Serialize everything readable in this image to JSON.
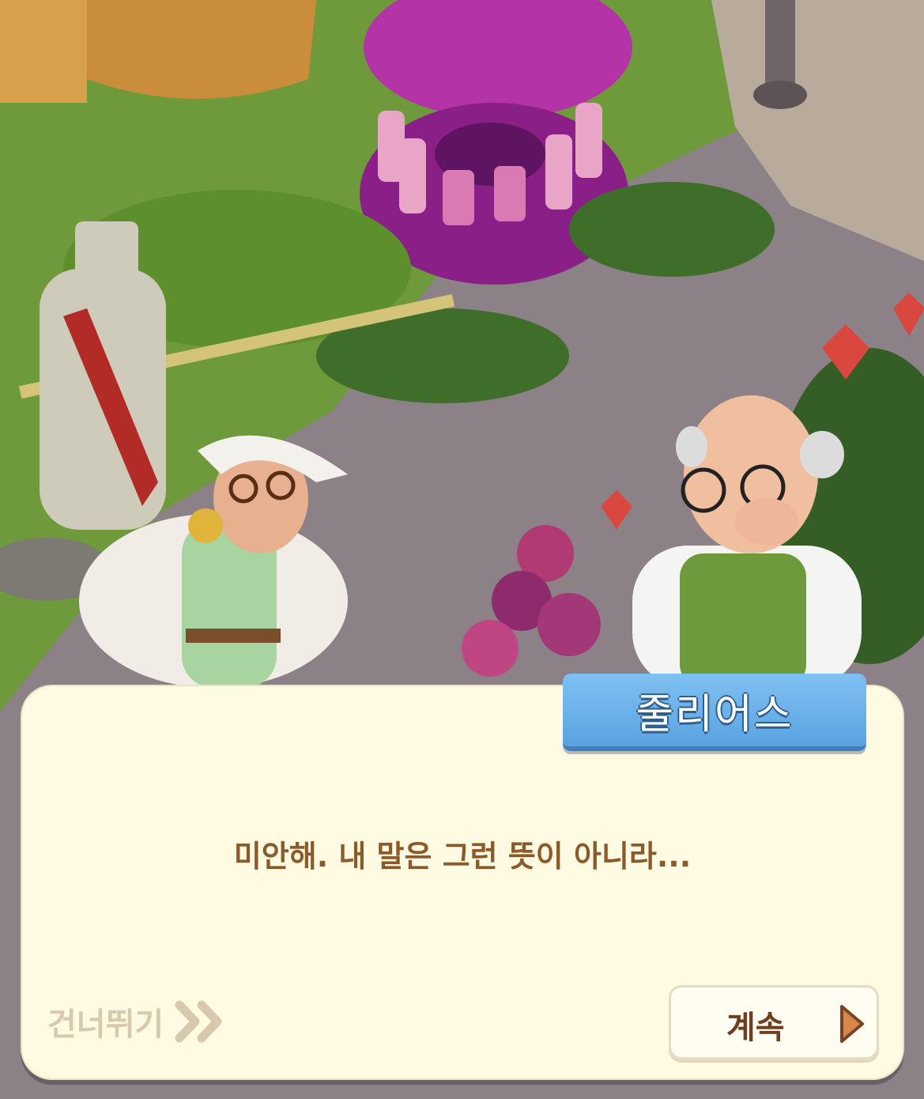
{
  "dialog": {
    "speaker_name": "줄리어스",
    "line": "미안해. 내 말은 그런 뜻이 아니라..."
  },
  "controls": {
    "skip_label": "건너뛰기",
    "skip_icon": "double-chevron-right-icon",
    "continue_label": "계속",
    "continue_icon": "play-triangle-icon"
  },
  "colors": {
    "dialog_bg": "#fffbe3",
    "name_plate": "#5aa3e0",
    "dialog_text": "#8a5a2b",
    "continue_text": "#6b3f1f",
    "skip_text": "#d8c8ae"
  }
}
